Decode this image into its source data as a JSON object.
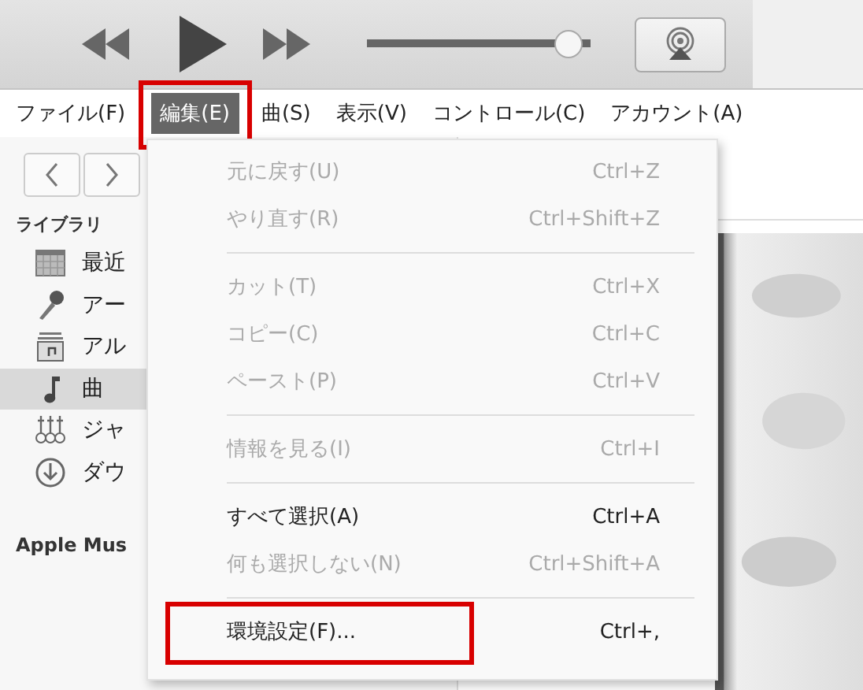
{
  "player": {
    "volume": {
      "level": 0.9
    }
  },
  "menubar": [
    {
      "label": "ファイル(F)",
      "selected": false,
      "annotated": false
    },
    {
      "label": "編集(E)",
      "selected": true,
      "annotated": true
    },
    {
      "label": "曲(S)",
      "selected": false,
      "annotated": false
    },
    {
      "label": "表示(V)",
      "selected": false,
      "annotated": false
    },
    {
      "label": "コントロール(C)",
      "selected": false,
      "annotated": false
    },
    {
      "label": "アカウント(A)",
      "selected": false,
      "annotated": false
    }
  ],
  "sidebar": {
    "sections": [
      {
        "title": "ライブラリ",
        "items": [
          {
            "label": "最近",
            "kind": "grid",
            "selected": false
          },
          {
            "label": "アー",
            "kind": "mic",
            "selected": false
          },
          {
            "label": "アル",
            "kind": "album",
            "selected": false
          },
          {
            "label": "曲",
            "kind": "note",
            "selected": true
          },
          {
            "label": "ジャ",
            "kind": "genre",
            "selected": false
          },
          {
            "label": "ダウ",
            "kind": "download",
            "selected": false
          }
        ]
      },
      {
        "title": "Apple Mus"
      }
    ]
  },
  "edit_menu": {
    "items": [
      {
        "kind": "item",
        "label": "元に戻す(U)",
        "shortcut": "Ctrl+Z",
        "disabled": true,
        "annotated": false
      },
      {
        "kind": "item",
        "label": "やり直す(R)",
        "shortcut": "Ctrl+Shift+Z",
        "disabled": true,
        "annotated": false
      },
      {
        "kind": "separator"
      },
      {
        "kind": "item",
        "label": "カット(T)",
        "shortcut": "Ctrl+X",
        "disabled": true,
        "annotated": false
      },
      {
        "kind": "item",
        "label": "コピー(C)",
        "shortcut": "Ctrl+C",
        "disabled": true,
        "annotated": false
      },
      {
        "kind": "item",
        "label": "ペースト(P)",
        "shortcut": "Ctrl+V",
        "disabled": true,
        "annotated": false
      },
      {
        "kind": "separator"
      },
      {
        "kind": "item",
        "label": "情報を見る(I)",
        "shortcut": "Ctrl+I",
        "disabled": true,
        "annotated": false
      },
      {
        "kind": "separator"
      },
      {
        "kind": "item",
        "label": "すべて選択(A)",
        "shortcut": "Ctrl+A",
        "disabled": false,
        "annotated": false
      },
      {
        "kind": "item",
        "label": "何も選択しない(N)",
        "shortcut": "Ctrl+Shift+A",
        "disabled": true,
        "annotated": false
      },
      {
        "kind": "separator"
      },
      {
        "kind": "item",
        "label": "環境設定(F)...",
        "shortcut": "Ctrl+,",
        "disabled": false,
        "annotated": true
      }
    ]
  }
}
